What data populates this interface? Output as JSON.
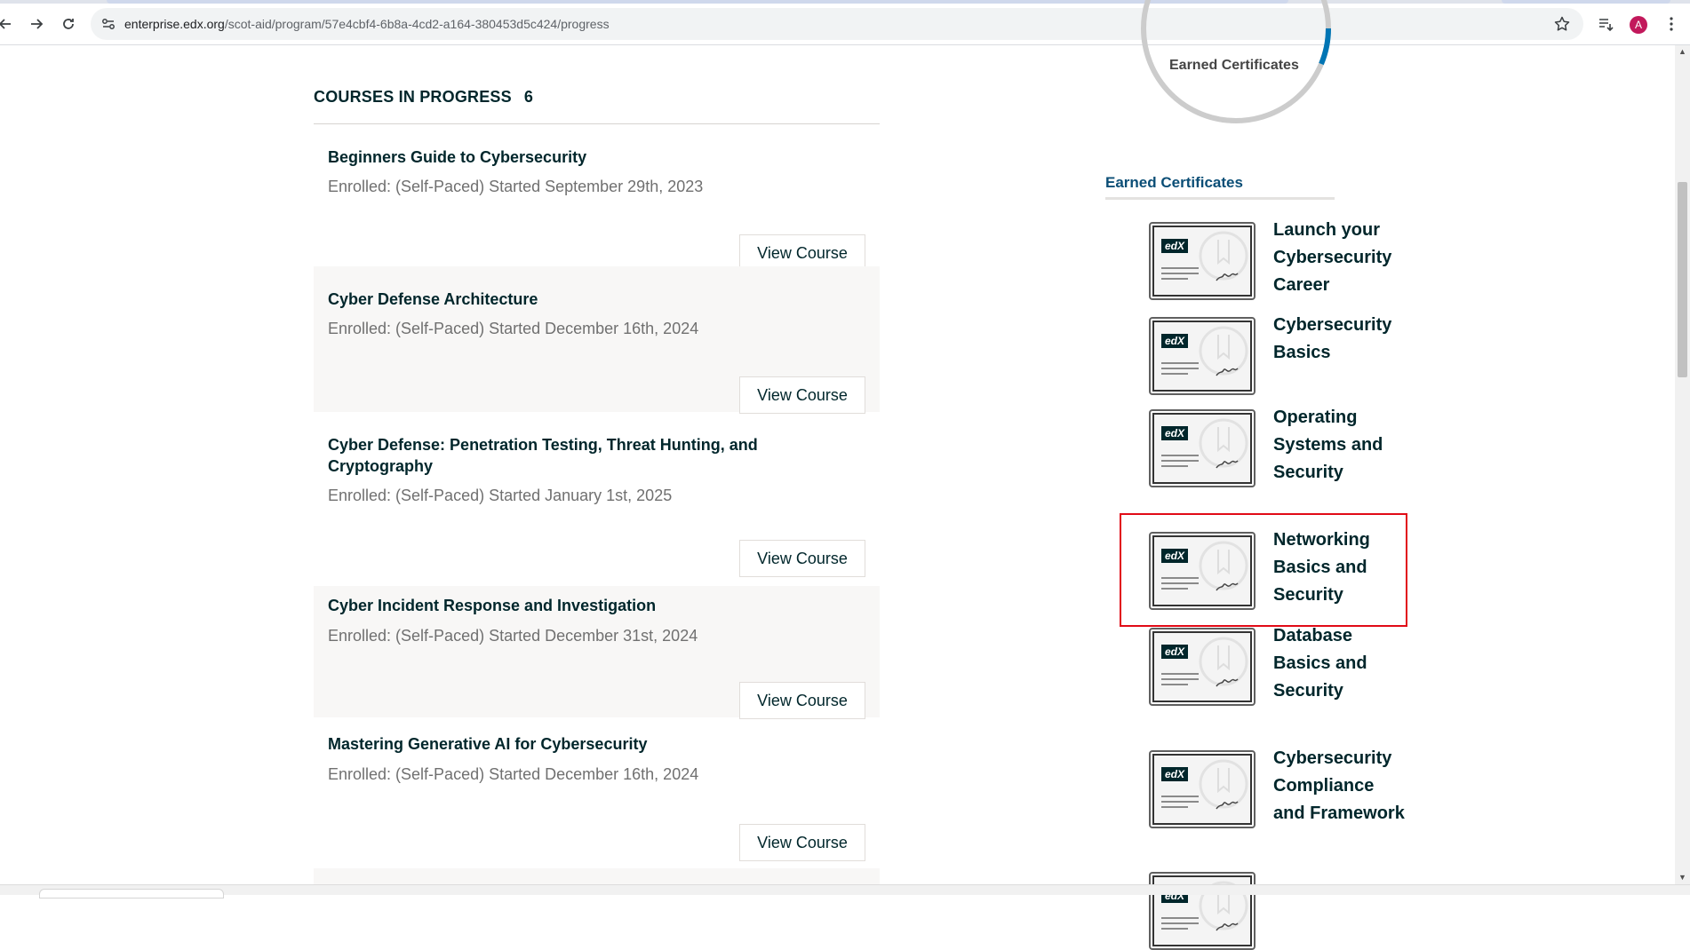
{
  "browser": {
    "url_host": "enterprise.edx.org",
    "url_path": "/scot-aid/program/57e4cbf4-6b8a-4cd2-a164-380453d5c424/progress",
    "profile_initial": "A"
  },
  "courses_section": {
    "heading": "COURSES IN PROGRESS",
    "count": "6",
    "view_course_label": "View Course"
  },
  "courses": [
    {
      "title": "Beginners Guide to Cybersecurity",
      "meta": "Enrolled: (Self-Paced) Started September 29th, 2023"
    },
    {
      "title": "Cyber Defense Architecture",
      "meta": "Enrolled: (Self-Paced) Started December 16th, 2024"
    },
    {
      "title": "Cyber Defense: Penetration Testing, Threat Hunting, and Cryptography",
      "meta": "Enrolled: (Self-Paced) Started January 1st, 2025"
    },
    {
      "title": "Cyber Incident Response and Investigation",
      "meta": "Enrolled: (Self-Paced) Started December 31st, 2024"
    },
    {
      "title": "Mastering Generative AI for Cybersecurity",
      "meta": "Enrolled: (Self-Paced) Started December 16th, 2024"
    }
  ],
  "progress_ring": {
    "label": "Earned Certificates"
  },
  "certificates_section": {
    "heading": "Earned Certificates"
  },
  "certificates": [
    {
      "name": "Launch your Cybersecurity Career"
    },
    {
      "name": "Cybersecurity Basics"
    },
    {
      "name": "Operating Systems and Security"
    },
    {
      "name": "Networking Basics and Security"
    },
    {
      "name": "Database Basics and Security"
    },
    {
      "name": "Cybersecurity Compliance and Framework"
    }
  ],
  "thumb_logo_text": "edX",
  "colors": {
    "heading_text": "#00262b",
    "link_blue": "#0b4e76",
    "ring_progress": "#0075b4",
    "highlight": "#e10a16"
  }
}
